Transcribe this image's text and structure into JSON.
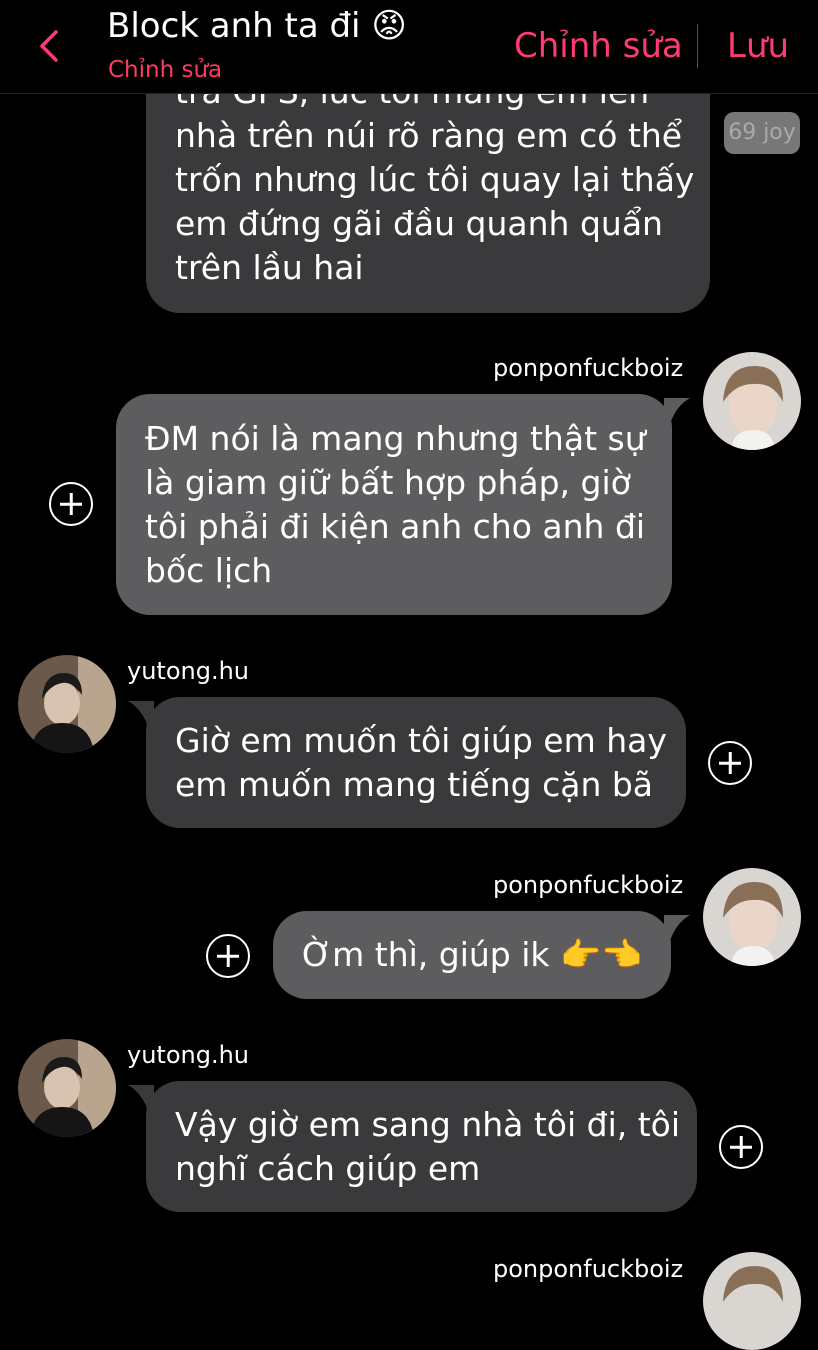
{
  "header": {
    "title": "Block anh ta đi 😡",
    "subtitle": "Chỉnh sửa",
    "edit_label": "Chỉnh sửa",
    "save_label": "Lưu"
  },
  "messages": [
    {
      "text": "tra GPS, lúc tôi mang em lên nhà trên núi rõ ràng em có thể trốn nhưng lúc tôi quay lại thấy em đứng gãi đầu quanh quẩn trên lầu hai",
      "lines": [
        "tra GPS, lúc tôi mang em lên",
        "nhà trên núi rõ ràng em có thể",
        "trốn nhưng lúc tôi quay lại thấy",
        "em đứng gãi đầu quanh quẩn",
        "trên lầu hai"
      ]
    },
    {
      "sender": "ponponfuckboiz",
      "lines": [
        "ĐM nói là mang nhưng thật sự",
        "là giam giữ bất hợp pháp, giờ",
        "tôi phải đi kiện anh cho anh đi",
        "bốc lịch"
      ]
    },
    {
      "sender": "yutong.hu",
      "lines": [
        "Giờ em muốn tôi giúp em hay",
        "em muốn mang tiếng cặn bã"
      ]
    },
    {
      "sender": "ponponfuckboiz",
      "lines": [
        "Ờm thì, giúp ik 👉👈"
      ]
    },
    {
      "sender": "yutong.hu",
      "lines": [
        "Vậy giờ em sang nhà tôi đi, tôi",
        "nghĩ cách giúp em"
      ]
    },
    {
      "sender": "ponponfuckboiz"
    }
  ],
  "watermark": "69 joy",
  "colors": {
    "accent": "#ff3b72",
    "bubble_dark": "#3a3a3c",
    "bubble_grey": "#5d5d5f"
  }
}
